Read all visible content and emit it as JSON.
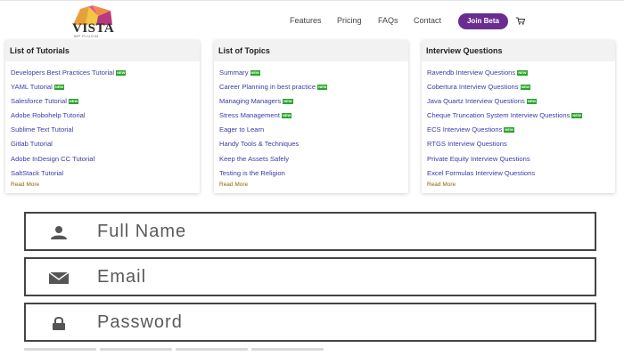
{
  "brand": {
    "name": "VISTA",
    "tagline": "WP PLUGIN"
  },
  "nav": {
    "features": "Features",
    "pricing": "Pricing",
    "faqs": "FAQs",
    "contact": "Contact",
    "cta": "Join Beta",
    "cart_icon": "cart-icon"
  },
  "colors": {
    "accent": "#6a2c91",
    "link": "#3b3ba8",
    "badge": "#2aa52a",
    "read_more": "#8a6a00"
  },
  "badge_label": "NEW",
  "cards": [
    {
      "title": "List of Tutorials",
      "items": [
        {
          "label": "Developers Best Practices Tutorial",
          "new": true
        },
        {
          "label": "YAML Tutorial",
          "new": true
        },
        {
          "label": "Salesforce Tutorial",
          "new": true
        },
        {
          "label": "Adobe Robohelp Tutorial",
          "new": false
        },
        {
          "label": "Sublime Text Tutorial",
          "new": false
        },
        {
          "label": "Gitlab Tutorial",
          "new": false
        },
        {
          "label": "Adobe InDesign CC Tutorial",
          "new": false
        },
        {
          "label": "SaltStack Tutorial",
          "new": false
        }
      ],
      "read_more": "Read More"
    },
    {
      "title": "List of Topics",
      "items": [
        {
          "label": "Summary",
          "new": true
        },
        {
          "label": "Career Planning in best practice",
          "new": true
        },
        {
          "label": "Managing Managers",
          "new": true
        },
        {
          "label": "Stress Management",
          "new": true
        },
        {
          "label": "Eager to Learn",
          "new": false
        },
        {
          "label": "Handy Tools & Techniques",
          "new": false
        },
        {
          "label": "Keep the Assets Safely",
          "new": false
        },
        {
          "label": "Testing is the Religion",
          "new": false
        }
      ],
      "read_more": "Read More"
    },
    {
      "title": "Interview Questions",
      "items": [
        {
          "label": "Ravendb Interview Questions",
          "new": true
        },
        {
          "label": "Cobertura Interview Questions",
          "new": true
        },
        {
          "label": "Java Quartz Interview Questions",
          "new": true
        },
        {
          "label": "Cheque Truncation System Interview Questions",
          "new": true
        },
        {
          "label": "ECS Interview Questions",
          "new": true
        },
        {
          "label": "RTGS Interview Questions",
          "new": false
        },
        {
          "label": "Private Equity Interview Questions",
          "new": false
        },
        {
          "label": "Excel Formulas Interview Questions",
          "new": false
        }
      ],
      "read_more": "Read More"
    }
  ],
  "form": {
    "fields": [
      {
        "placeholder": "Full Name",
        "value": "",
        "icon": "user-icon"
      },
      {
        "placeholder": "Email",
        "value": "",
        "icon": "envelope-icon"
      },
      {
        "placeholder": "Password",
        "value": "",
        "icon": "lock-icon"
      }
    ]
  }
}
